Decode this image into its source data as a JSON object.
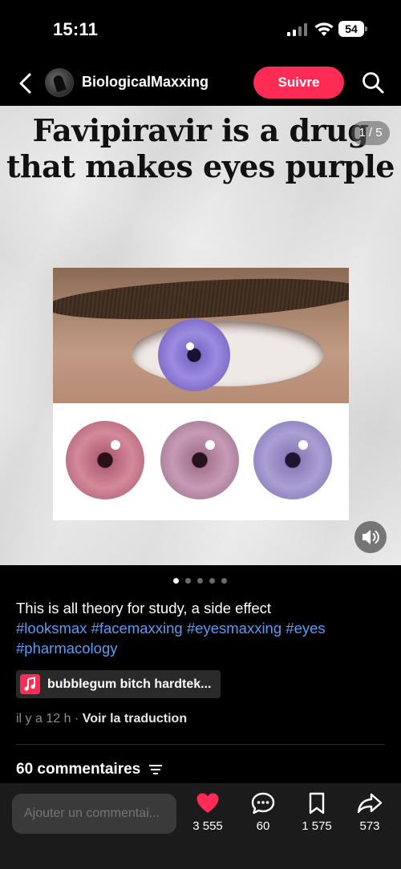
{
  "status_bar": {
    "time": "15:11",
    "battery": "54"
  },
  "header": {
    "username": "BiologicalMaxxing",
    "follow_label": "Suivre"
  },
  "media": {
    "title_line1": "Favipiravir is a drug",
    "title_line2": "that makes eyes purple",
    "page_counter": "1 / 5",
    "dots_total": 5,
    "dots_active": 1
  },
  "post": {
    "caption_text": "This is all theory for study, a side effect",
    "hashtags": [
      "#looksmax",
      "#facemaxxing",
      "#eyesmaxxing",
      "#eyes",
      "#pharmacology"
    ],
    "music_title": "bubblegum bitch hardtek...",
    "time_ago": "il y a 12 h",
    "separator": "·",
    "translate_label": "Voir la traduction"
  },
  "comments": {
    "header": "60 commentaires"
  },
  "bottom_bar": {
    "input_placeholder": "Ajouter un commentai...",
    "likes": "3 555",
    "comments": "60",
    "saves": "1 575",
    "shares": "573"
  },
  "colors": {
    "accent": "#fe2c55",
    "hashtag": "#5b9bf5",
    "like": "#fe2c55"
  },
  "icons": [
    "back-icon",
    "search-icon",
    "sound-icon",
    "music-icon",
    "sort-icon",
    "heart-icon",
    "comment-icon",
    "bookmark-icon",
    "share-icon"
  ]
}
